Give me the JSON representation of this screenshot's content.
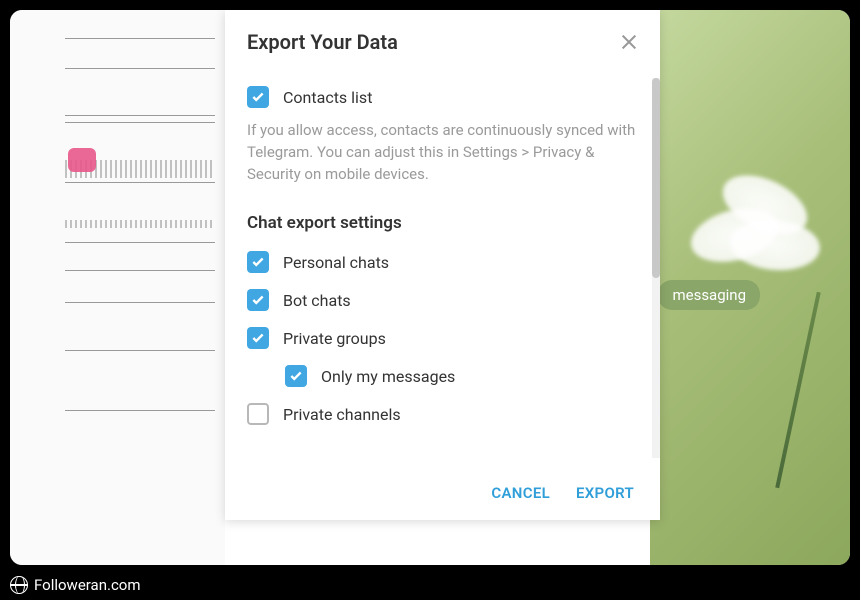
{
  "dialog": {
    "title": "Export Your Data",
    "contacts": {
      "label": "Contacts list",
      "checked": true,
      "description": "If you allow access, contacts are continuously synced with Telegram. You can adjust this in Settings > Privacy & Security on mobile devices."
    },
    "chat_section_heading": "Chat export settings",
    "chats": [
      {
        "label": "Personal chats",
        "checked": true
      },
      {
        "label": "Bot chats",
        "checked": true
      },
      {
        "label": "Private groups",
        "checked": true
      },
      {
        "label": "Only my messages",
        "checked": true,
        "indented": true
      },
      {
        "label": "Private channels",
        "checked": false
      }
    ],
    "buttons": {
      "cancel": "CANCEL",
      "export": "EXPORT"
    }
  },
  "background": {
    "badge_text": "messaging"
  },
  "watermark": "Followeran.com"
}
